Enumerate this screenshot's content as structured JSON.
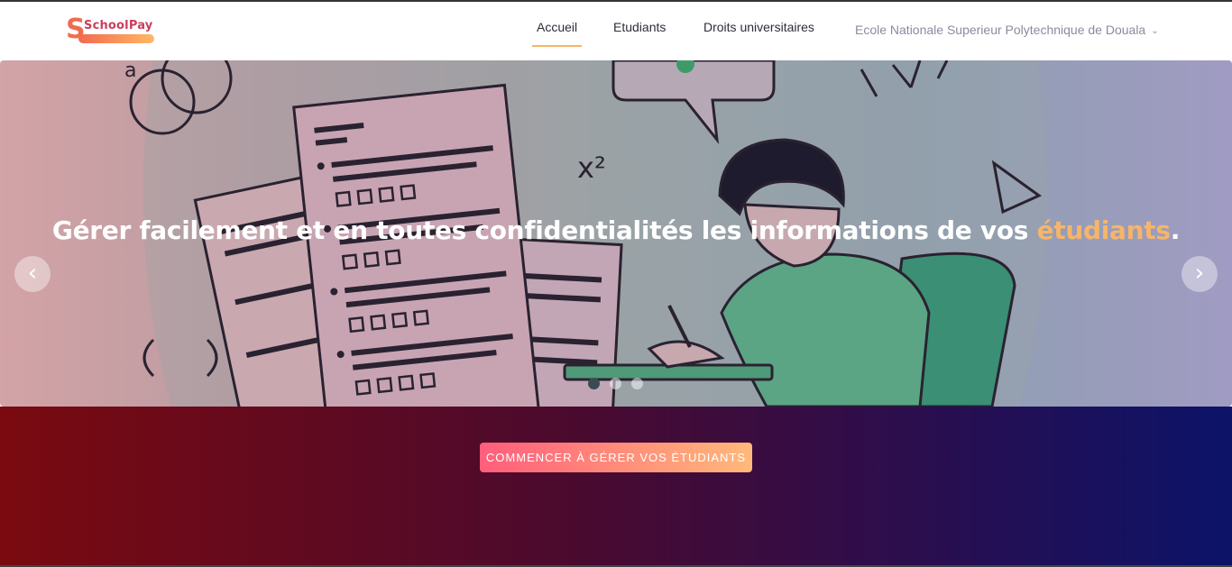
{
  "brand": {
    "logo_text": "SchoolPay",
    "logo_initial": "S"
  },
  "nav": {
    "items": [
      {
        "label": "Accueil",
        "active": true
      },
      {
        "label": "Etudiants",
        "active": false
      },
      {
        "label": "Droits universitaires",
        "active": false
      }
    ],
    "school_selector": "Ecole Nationale Superieur Polytechnique de Douala"
  },
  "hero": {
    "title_prefix": "Gérer facilement et en toutes confidentialités les informations de vos ",
    "title_highlight": "étudiants",
    "title_suffix": ".",
    "slides_count": 3,
    "active_slide": 1,
    "prev_glyph": "‹",
    "next_glyph": "›",
    "formula": "x²"
  },
  "cta": {
    "label": "COMMENCER À GÉRER VOS ÉTUDIANTS"
  },
  "colors": {
    "accent": "#f5b56a",
    "cta_start": "#ff5e7b",
    "cta_end": "#ffb97a"
  }
}
